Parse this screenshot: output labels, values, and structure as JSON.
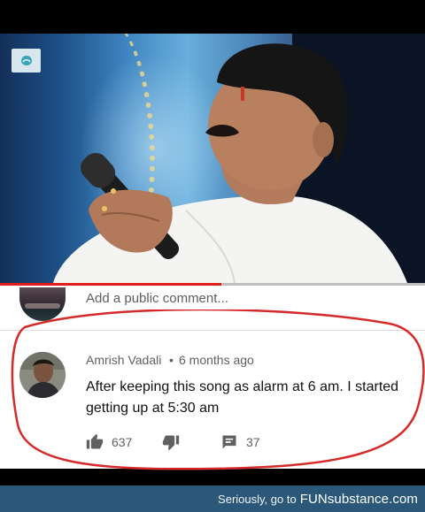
{
  "video": {
    "logo_icon": "channel-logo-icon"
  },
  "playback": {
    "progress_fraction": 0.52,
    "progress_color": "#e31b1b"
  },
  "comment_box": {
    "placeholder": "Add a public comment..."
  },
  "comment": {
    "author": "Amrish Vadali",
    "separator": "•",
    "time": "6 months ago",
    "text": "After keeping this song as alarm at 6 am. I started getting up at 5:30 am",
    "likes": "637",
    "replies": "37"
  },
  "watermark": {
    "text": "Seriously, go to",
    "brand": "FUNsubstance.com",
    "bar_color": "#2b5878"
  },
  "colors": {
    "annotation_circle": "#d62a2a"
  }
}
